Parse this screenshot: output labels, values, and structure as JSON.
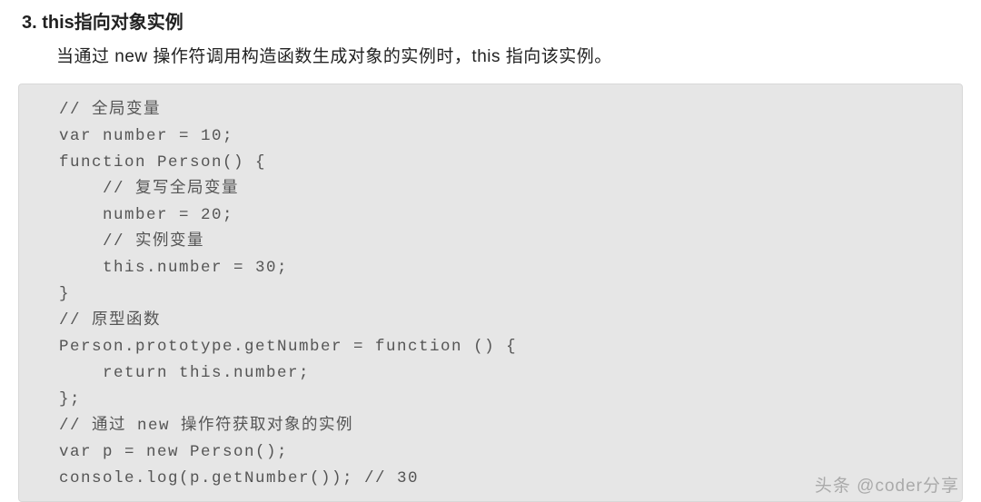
{
  "heading": "3. this指向对象实例",
  "paragraph": "当通过 new 操作符调用构造函数生成对象的实例时，this 指向该实例。",
  "code": "// 全局变量\nvar number = 10;\nfunction Person() {\n    // 复写全局变量\n    number = 20;\n    // 实例变量\n    this.number = 30;\n}\n// 原型函数\nPerson.prototype.getNumber = function () {\n    return this.number;\n};\n// 通过 new 操作符获取对象的实例\nvar p = new Person();\nconsole.log(p.getNumber()); // 30",
  "watermark": "头条 @coder分享"
}
